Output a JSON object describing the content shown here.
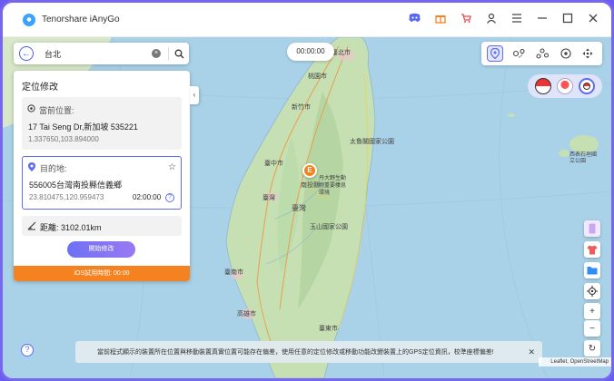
{
  "app": {
    "title": "Tenorshare iAnyGo"
  },
  "titlebar": {
    "icons": [
      "discord-icon",
      "gift-icon",
      "cart-icon",
      "user-icon",
      "menu-icon",
      "minimize-icon",
      "maximize-icon",
      "close-icon"
    ]
  },
  "search": {
    "value": "台北"
  },
  "timer": {
    "value": "00:00:00"
  },
  "panel": {
    "title": "定位修改",
    "current": {
      "label": "當前位置:",
      "address": "17 Tai Seng Dr,新加坡 535221",
      "coords": "1.337650,103.894000"
    },
    "destination": {
      "label": "目的地:",
      "address": "556005台灣南投縣信義鄉",
      "coords": "23.810475,120.959473",
      "time": "02:00:00"
    },
    "distance": "距離: 3102.01km",
    "start_button": "開始修改",
    "trial": "iOS試用時間: 00:00"
  },
  "map": {
    "marker": "E",
    "labels": {
      "taipei": "臺北市",
      "taoyuan": "桃園市",
      "hsinchu": "新竹市",
      "taichung": "臺中市",
      "hualien_park": "太魯閣國家公園",
      "taiwan": "臺灣",
      "taiwan2": "臺灣",
      "nantou": "南投縣",
      "yushan": "丹大野生動物重要棲息環境",
      "yushan_park": "玉山國家公園",
      "tainan": "臺南市",
      "kaohsiung": "高雄市",
      "taitung": "臺東市",
      "jiayi": "嘉義市",
      "okinawa": "西表石垣國立公園"
    }
  },
  "notice": {
    "text": "當前程式顯示的裝置所在位置與移動裝置真實位置可能存在偏差，使用任意的定位修改或移動功能改變裝置上的GPS定位資訊，校準座標偏差!"
  },
  "attribution": "Leaflet, OpenStreetMap",
  "colors": {
    "accent": "#5d6cf0",
    "trial": "#f58220",
    "marker": "#f58220",
    "land": "#c6e0b4",
    "sea": "#a9d2e8"
  }
}
